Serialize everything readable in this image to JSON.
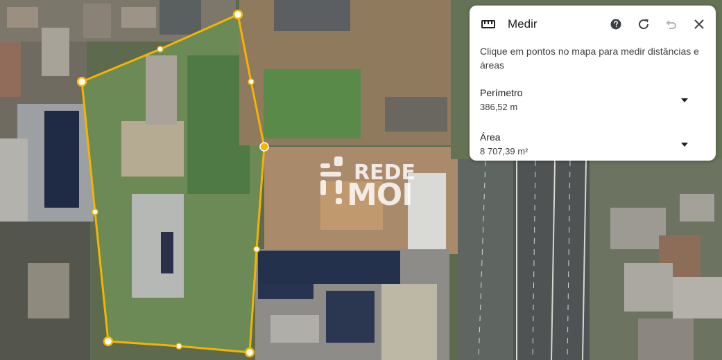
{
  "panel": {
    "title": "Medir",
    "instruction": "Clique em pontos no mapa para medir distâncias e áreas",
    "help_icon": "help-circle-icon",
    "refresh_icon": "refresh-icon",
    "undo_icon": "undo-icon",
    "close_icon": "close-icon",
    "ruler_icon": "ruler-icon",
    "perimeter": {
      "label": "Perímetro",
      "value": "386,52 m"
    },
    "area": {
      "label": "Área",
      "value": "8 707,39 m²"
    }
  },
  "watermark": {
    "line1": "REDE",
    "line2": "MOI"
  },
  "colors": {
    "measure_line": "#f4b400",
    "panel_bg": "#ffffff",
    "text_primary": "#202124"
  }
}
